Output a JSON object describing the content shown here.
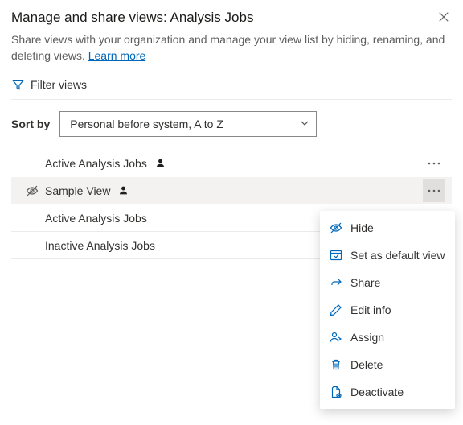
{
  "header": {
    "title": "Manage and share views: Analysis Jobs"
  },
  "description": {
    "text": "Share views with your organization and manage your view list by hiding, renaming, and deleting views. ",
    "link": "Learn more"
  },
  "filter": {
    "label": "Filter views"
  },
  "sort": {
    "label": "Sort by",
    "selected": "Personal before system, A to Z"
  },
  "views": [
    {
      "label": "Active Analysis Jobs",
      "personal": true,
      "hidden": false,
      "selected": false,
      "showMore": true
    },
    {
      "label": "Sample View",
      "personal": true,
      "hidden": true,
      "selected": true,
      "showMore": true
    },
    {
      "label": "Active Analysis Jobs",
      "personal": false,
      "hidden": false,
      "selected": false,
      "showMore": false
    },
    {
      "label": "Inactive Analysis Jobs",
      "personal": false,
      "hidden": false,
      "selected": false,
      "showMore": false
    }
  ],
  "menu": {
    "items": [
      {
        "icon": "hide",
        "label": "Hide"
      },
      {
        "icon": "default",
        "label": "Set as default view"
      },
      {
        "icon": "share",
        "label": "Share"
      },
      {
        "icon": "edit",
        "label": "Edit info"
      },
      {
        "icon": "assign",
        "label": "Assign"
      },
      {
        "icon": "delete",
        "label": "Delete"
      },
      {
        "icon": "deactivate",
        "label": "Deactivate"
      }
    ]
  }
}
